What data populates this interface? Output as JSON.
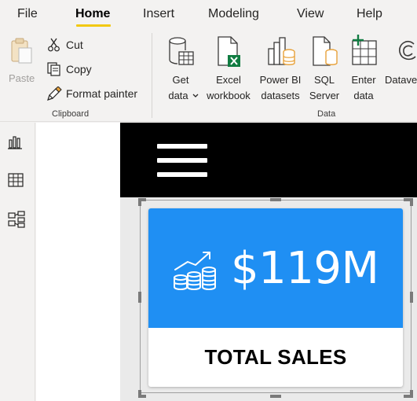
{
  "menu": {
    "tabs": [
      "File",
      "Home",
      "Insert",
      "Modeling",
      "View",
      "Help"
    ],
    "active": "Home"
  },
  "ribbon": {
    "clipboard": {
      "paste_label": "Paste",
      "cut_label": "Cut",
      "copy_label": "Copy",
      "format_painter_label": "Format painter",
      "group_label": "Clipboard"
    },
    "data": {
      "get_data": [
        "Get",
        "data"
      ],
      "excel": [
        "Excel",
        "workbook"
      ],
      "powerbi": [
        "Power BI",
        "datasets"
      ],
      "sql": [
        "SQL",
        "Server"
      ],
      "enter": [
        "Enter",
        "data"
      ],
      "dataverse": "Datave",
      "group_label": "Data"
    }
  },
  "leftnav": [
    "report-view-icon",
    "data-view-icon",
    "model-view-icon"
  ],
  "card": {
    "value": "$119M",
    "label": "TOTAL SALES"
  },
  "colors": {
    "accent": "#f2c811",
    "card_blue": "#1f8ff3",
    "excel_green": "#107c41",
    "sql_orange": "#e8a33d"
  }
}
